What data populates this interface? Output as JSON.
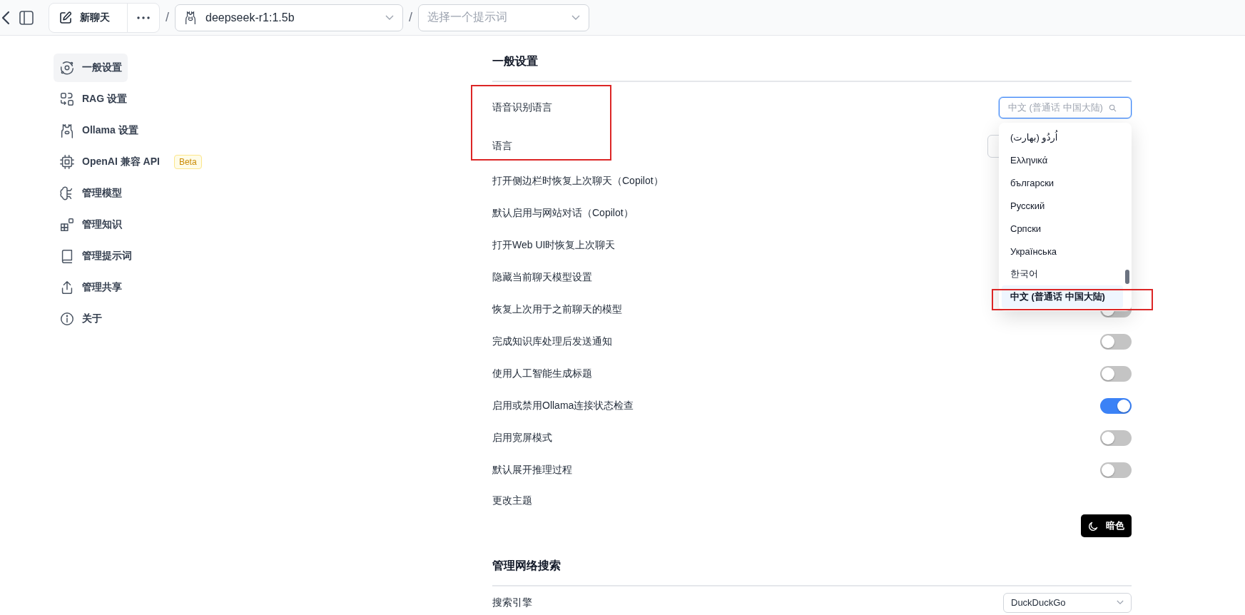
{
  "top_bar": {
    "new_chat": "新聊天",
    "separators": [
      "/",
      "/"
    ],
    "model": "deepseek-r1:1.5b",
    "prompt_placeholder": "选择一个提示词"
  },
  "sidebar": {
    "items": [
      {
        "label": "一般设置",
        "selected": true
      },
      {
        "label": "RAG 设置",
        "selected": false
      },
      {
        "label": "Ollama 设置",
        "selected": false
      },
      {
        "label": "OpenAI 兼容 API",
        "selected": false,
        "badge": "Beta"
      },
      {
        "label": "管理模型",
        "selected": false
      },
      {
        "label": "管理知识",
        "selected": false
      },
      {
        "label": "管理提示词",
        "selected": false
      },
      {
        "label": "管理共享",
        "selected": false
      },
      {
        "label": "关于",
        "selected": false
      }
    ]
  },
  "general": {
    "title": "一般设置",
    "annotated": true,
    "speech_language": {
      "label": "语音识别语言",
      "placeholder": "中文 (普通话 中国大陆)",
      "focused": true,
      "options": [
        {
          "label": "اُردُو (بھارت)",
          "selected": false
        },
        {
          "label": "Ελληνικά",
          "selected": false
        },
        {
          "label": "български",
          "selected": false
        },
        {
          "label": "Русский",
          "selected": false
        },
        {
          "label": "Српски",
          "selected": false
        },
        {
          "label": "Українська",
          "selected": false
        },
        {
          "label": "한국어",
          "selected": false
        },
        {
          "label": "中文 (普通话 中国大陆)",
          "selected": true,
          "annotated": true
        }
      ]
    },
    "language": {
      "label": "语言"
    },
    "rows": [
      {
        "kind": "toggle",
        "label": "打开侧边栏时恢复上次聊天（Copilot）"
      },
      {
        "kind": "toggle",
        "label": "默认启用与网站对话（Copilot）"
      },
      {
        "kind": "toggle",
        "label": "打开Web UI时恢复上次聊天"
      },
      {
        "kind": "toggle",
        "label": "隐藏当前聊天模型设置"
      },
      {
        "kind": "toggle",
        "label": "恢复上次用于之前聊天的模型",
        "on": false
      },
      {
        "kind": "toggle",
        "label": "完成知识库处理后发送通知",
        "on": false
      },
      {
        "kind": "toggle",
        "label": "使用人工智能生成标题",
        "on": false
      },
      {
        "kind": "toggle",
        "label": "启用或禁用Ollama连接状态检查",
        "on": true
      },
      {
        "kind": "toggle",
        "label": "启用宽屏模式",
        "on": false
      },
      {
        "kind": "toggle",
        "label": "默认展开推理过程",
        "on": false
      },
      {
        "kind": "theme",
        "label": "更改主题",
        "button": "暗色"
      }
    ]
  },
  "web_search": {
    "title": "管理网络搜索",
    "rows": [
      {
        "kind": "select",
        "label": "搜索引擎",
        "value": "DuckDuckGo"
      }
    ]
  }
}
